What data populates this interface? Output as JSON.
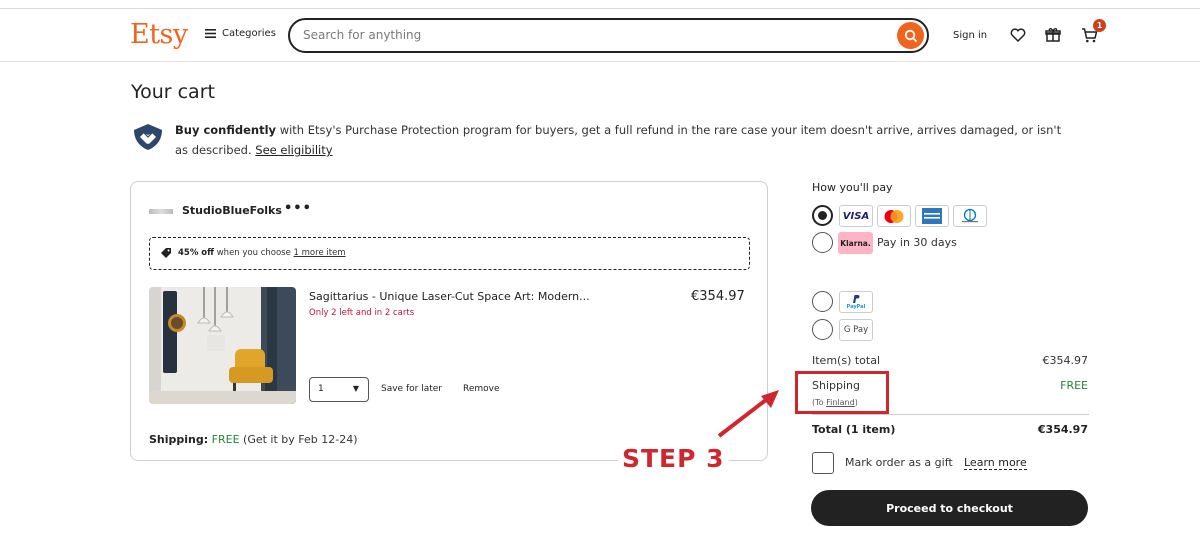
{
  "header": {
    "logo": "Etsy",
    "categories_label": "Categories",
    "search_placeholder": "Search for anything",
    "sign_in": "Sign in",
    "cart_count": "1"
  },
  "page": {
    "title": "Your cart",
    "protection": {
      "bold": "Buy confidently",
      "text": " with Etsy's Purchase Protection program for buyers, get a full refund in the rare case your item doesn't arrive, arrives damaged, or isn't as described. ",
      "link": "See eligibility"
    }
  },
  "shop": {
    "name": "StudioBlueFolks",
    "more": "•••",
    "promo": {
      "bold": "45% off",
      "text": " when you choose ",
      "link": "1 more item"
    },
    "item": {
      "title": "Sagittarius - Unique Laser-Cut Space Art: Modern...",
      "stock": "Only 2 left and in 2 carts",
      "price": "€354.97",
      "quantity": "1",
      "save_for_later": "Save for later",
      "remove": "Remove"
    },
    "shipping": {
      "label": "Shipping:",
      "value": "FREE",
      "eta": " (Get it by Feb 12-24)"
    }
  },
  "payment": {
    "heading": "How you'll pay",
    "options": [
      {
        "name": "card",
        "selected": true,
        "logos": [
          "VISA",
          "mastercard",
          "AMEX",
          "Diners Club"
        ]
      },
      {
        "name": "klarna",
        "selected": false,
        "logo": "Klarna.",
        "label": "Pay in 30 days"
      },
      {
        "name": "paypal",
        "selected": false,
        "logo": "PayPal"
      },
      {
        "name": "gpay",
        "selected": false,
        "logo": "G Pay"
      }
    ]
  },
  "summary": {
    "items_total_label": "Item(s) total",
    "items_total_value": "€354.97",
    "shipping_label": "Shipping",
    "shipping_to_prefix": "(To ",
    "shipping_to_country": "Finland",
    "shipping_to_suffix": ")",
    "shipping_value": "FREE",
    "total_label": "Total (1 item)",
    "total_value": "€354.97",
    "gift_label": "Mark order as a gift",
    "gift_link": "Learn more",
    "checkout": "Proceed to checkout"
  },
  "annotation": {
    "step": "STEP 3",
    "color": "#d0262e"
  },
  "colors": {
    "brand": "#f1641e",
    "free": "#258635",
    "stock": "#c4153b",
    "button": "#222222"
  }
}
